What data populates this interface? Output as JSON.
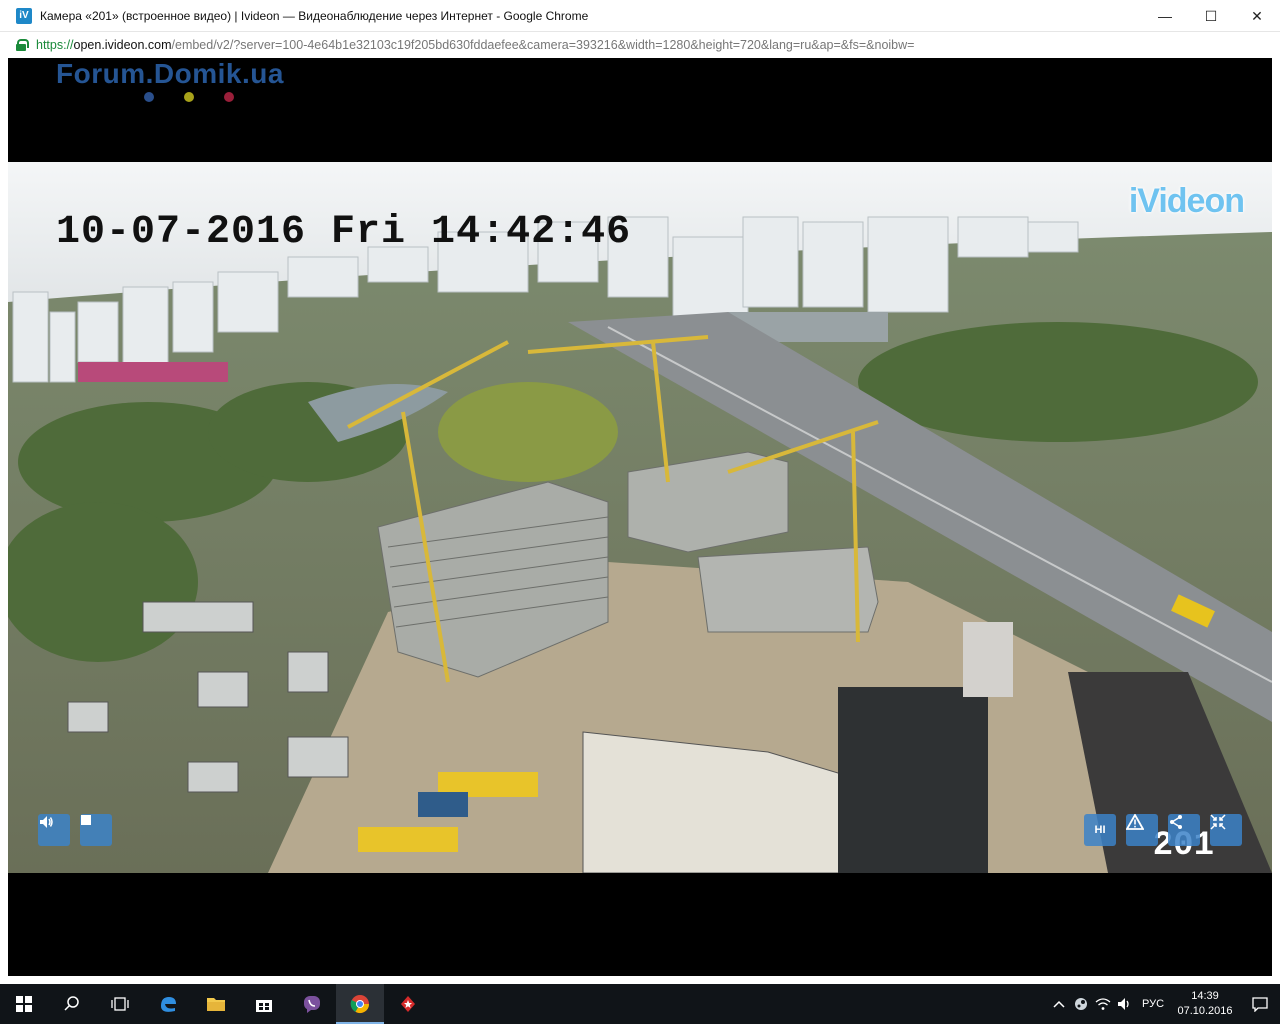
{
  "window": {
    "title": "Камера «201» (встроенное видео) | Ivideon — Видеонаблюдение через Интернет - Google Chrome",
    "app_icon_label": "iV",
    "minimize": "—",
    "maximize": "☐",
    "close": "✕"
  },
  "address": {
    "scheme": "https://",
    "host": "open.ivideon.com",
    "path": "/embed/v2/?server=100-4e64b1e32103c19f205bd630fddaefee&camera=393216&width=1280&height=720&lang=ru&ap=&fs=&noibw="
  },
  "watermark": {
    "text": "Forum.Domik.ua",
    "dot_colors": [
      "#2a4f8c",
      "#a8a21a",
      "#9a1f3a"
    ]
  },
  "video": {
    "timestamp": "10-07-2016 Fri 14:42:46",
    "logo": "iVideon",
    "camera_name": "201",
    "sound_icon": "speaker-icon",
    "stop_icon": "stop-icon",
    "quality_label": "HI",
    "alert_icon": "warning-icon",
    "share_icon": "share-icon",
    "exit_fullscreen_icon": "collapse-icon"
  },
  "taskbar": {
    "items": [
      "windows-start-icon",
      "search-icon",
      "task-view-icon",
      "edge-icon",
      "file-explorer-icon",
      "store-icon",
      "viber-icon",
      "chrome-icon",
      "pokerstars-icon"
    ],
    "language": "РУС",
    "time": "14:39",
    "date": "07.10.2016"
  }
}
